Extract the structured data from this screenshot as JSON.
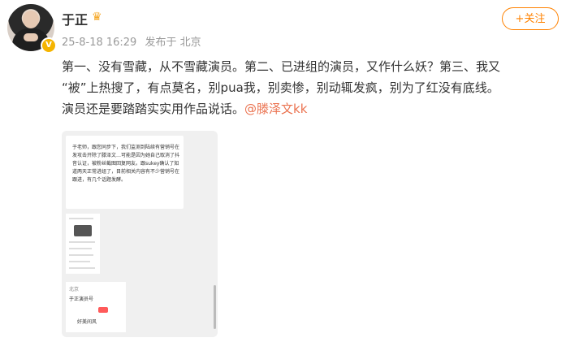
{
  "post": {
    "username": "于正",
    "crown_icon": "crown-icon",
    "verified_icon": "verified-v-icon",
    "time": "25-8-18 16:29",
    "source": "发布于 北京",
    "follow_label": "+关注",
    "text_lines": [
      "第一、没有雪藏，从不雪藏演员。第二、已进组的演员，又作什么妖？第三、我又",
      "“被”上热搜了，有点莫名，别pua我，别卖惨，别动辄发疯，别为了红没有底线。",
      "演员还是要踏踏实实用作品说话。"
    ],
    "mention": "@滕泽文kk"
  },
  "image": {
    "card_text": "于老师，跟您同步下，我们监测到陆续有营销号在发攻击开除了滕泽文…可能是因为她自己取消了抖音认证，被粉丝截图回复网友。跟sukey确认了知道两天正常进组了，目前相关内容有不少营销号在跟进，有几个话题发酵。",
    "bottom_title": "北京",
    "bottom_name": "于正演员号",
    "bottom_reply": "好美间风"
  },
  "colors": {
    "accent": "#ff8200",
    "mention": "#eb7350",
    "verified": "#f5b400"
  }
}
